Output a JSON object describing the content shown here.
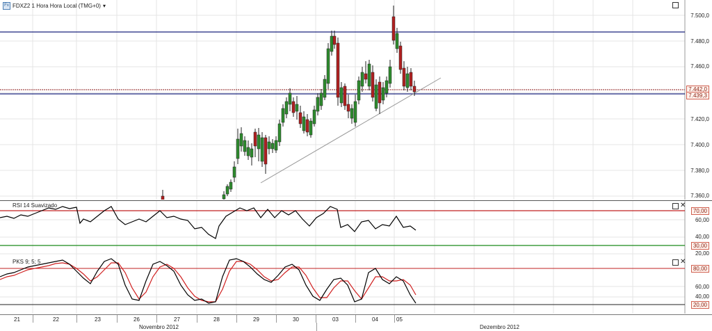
{
  "symbol_title": "FDXZ2 1 Hora Hora Local (TMG+0)",
  "symbol_icon": "chart-symbol-icon",
  "rsi_title": "RSI 14 Suavizado",
  "pks_title": "PKS 9; 5; 5",
  "price_axis": {
    "labels": [
      "7.500,0",
      "7.480,0",
      "7.460,0",
      "7.440,0",
      "7.420,0",
      "7.400,0",
      "7.380,0",
      "7.360,0"
    ],
    "current_price": "7.442,0",
    "line_price": "7.439,3"
  },
  "rsi_axis": {
    "labels": [
      "60,00",
      "40,00",
      "20,00"
    ],
    "upper": "70,00",
    "lower": "30,00"
  },
  "pks_axis": {
    "labels": [
      "60,00",
      "40,00"
    ],
    "upper": "80,00",
    "lower": "20,00"
  },
  "time_axis": {
    "days": [
      "21",
      "22",
      "23",
      "26",
      "27",
      "28",
      "29",
      "30",
      "03",
      "04",
      "05"
    ],
    "months": [
      "Novembro 2012",
      "Dezembro 2012"
    ]
  },
  "colors": {
    "up": "#2e8b2e",
    "down": "#b02020",
    "hline": "#1a237e",
    "rsi_upper": "#c02020",
    "rsi_lower": "#1a8a1a",
    "pks_k": "#000000",
    "pks_d": "#d02020"
  }
}
